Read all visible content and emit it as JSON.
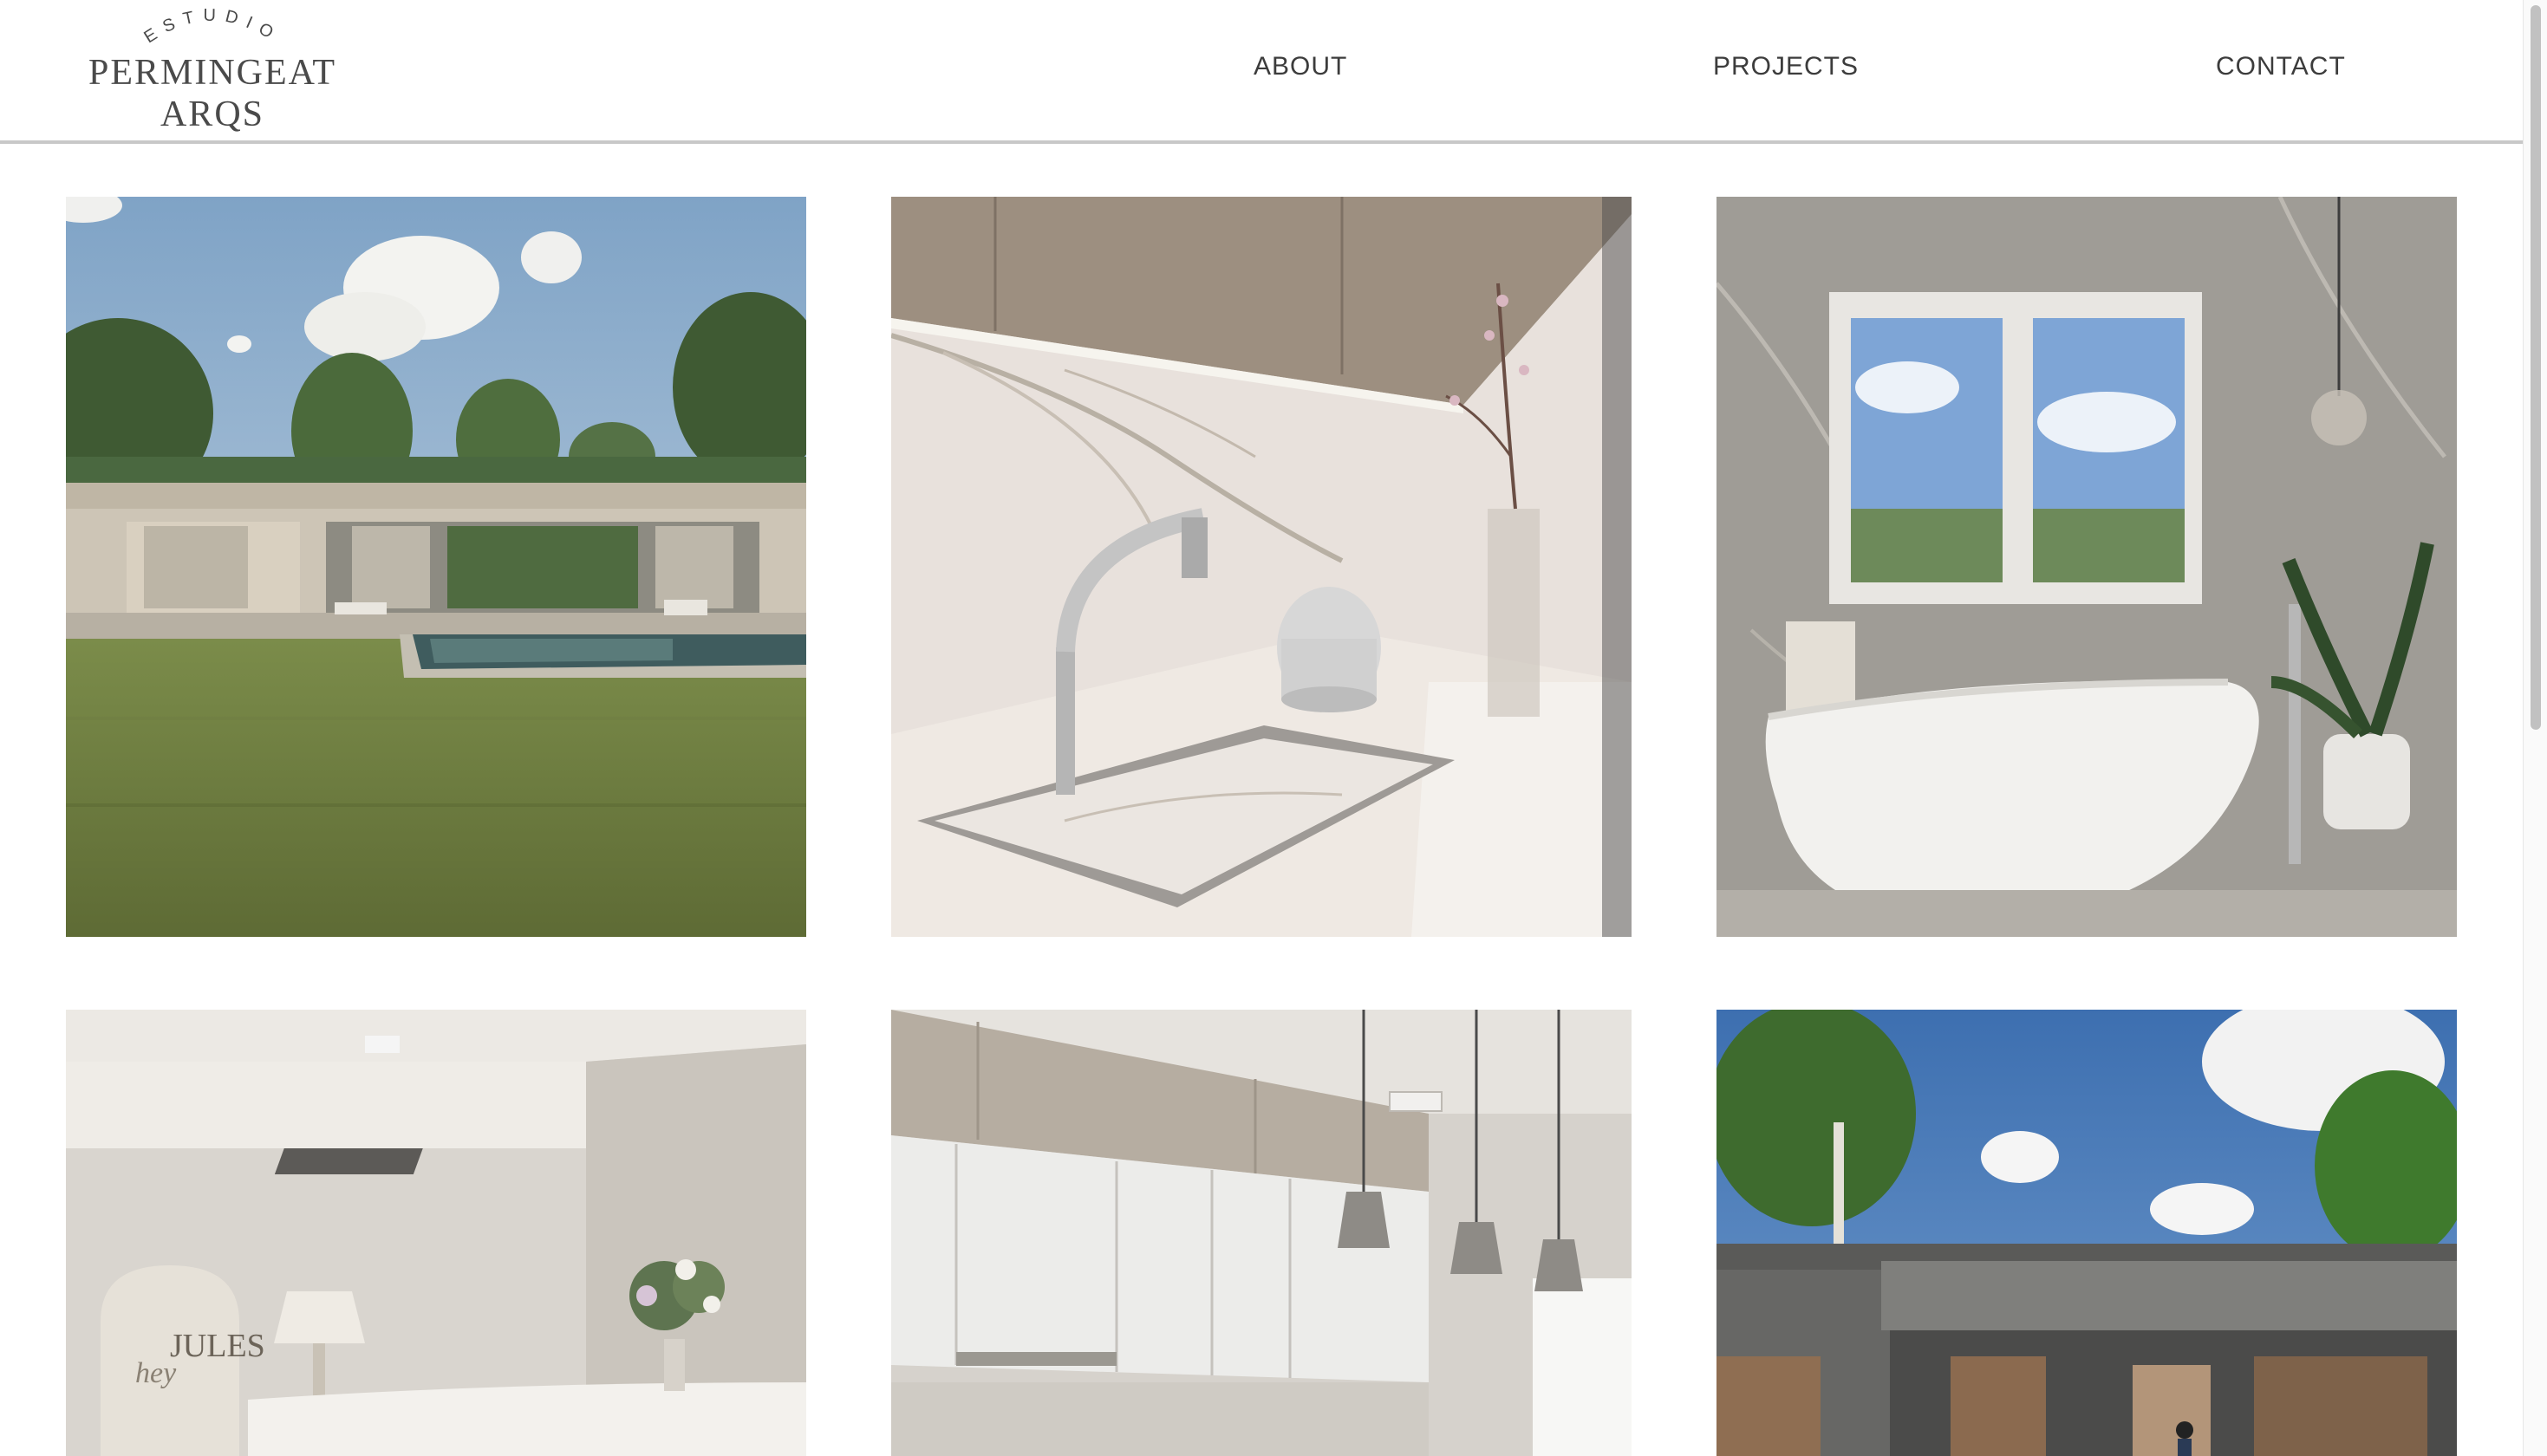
{
  "brand": {
    "tagline": "ESTUDIO",
    "name_line1": "PERMINGEAT",
    "name_line2": "ARQS"
  },
  "nav": {
    "items": [
      {
        "label": "ABOUT"
      },
      {
        "label": "PROJECTS"
      },
      {
        "label": "CONTACT"
      }
    ]
  },
  "projects": {
    "tiles": [
      {
        "subject": "house-with-pool-render"
      },
      {
        "subject": "kitchen-sink-marble"
      },
      {
        "subject": "bathroom-freestanding-tub"
      },
      {
        "subject": "reception-desk",
        "signage_script": "hey",
        "signage_name": "JULES"
      },
      {
        "subject": "kitchen-pendant-lights"
      },
      {
        "subject": "house-facade-render"
      }
    ]
  },
  "colors": {
    "text": "#4a4a4a",
    "divider": "#c8c8c8",
    "background": "#ffffff"
  }
}
